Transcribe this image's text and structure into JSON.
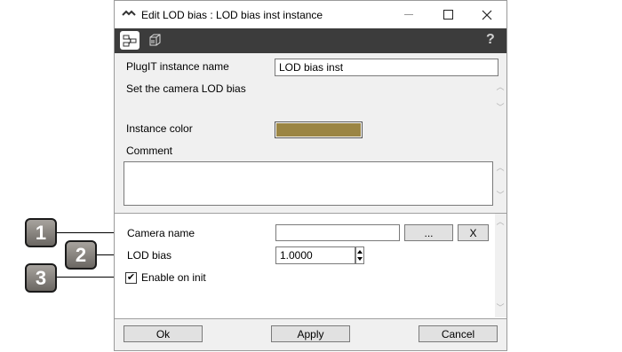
{
  "window": {
    "title": "Edit LOD bias : LOD bias inst instance",
    "minimize_glyph": "—",
    "maximize_glyph": "☐",
    "close_glyph": "✕"
  },
  "toolbar": {
    "help_glyph": "?"
  },
  "general": {
    "instance_name_label": "PlugIT instance name",
    "instance_name_value": "LOD bias inst",
    "description": "Set the camera LOD bias",
    "instance_color_label": "Instance color",
    "instance_color_hex": "#9b8543",
    "comment_label": "Comment",
    "comment_value": ""
  },
  "params": {
    "camera_name_label": "Camera name",
    "camera_name_value": "",
    "browse_button": "...",
    "clear_button": "X",
    "lod_bias_label": "LOD bias",
    "lod_bias_value": "1.0000",
    "enable_on_init_label": "Enable on init",
    "enable_on_init_checked": true
  },
  "footer": {
    "ok_label": "Ok",
    "apply_label": "Apply",
    "cancel_label": "Cancel"
  },
  "callouts": [
    "1",
    "2",
    "3"
  ]
}
